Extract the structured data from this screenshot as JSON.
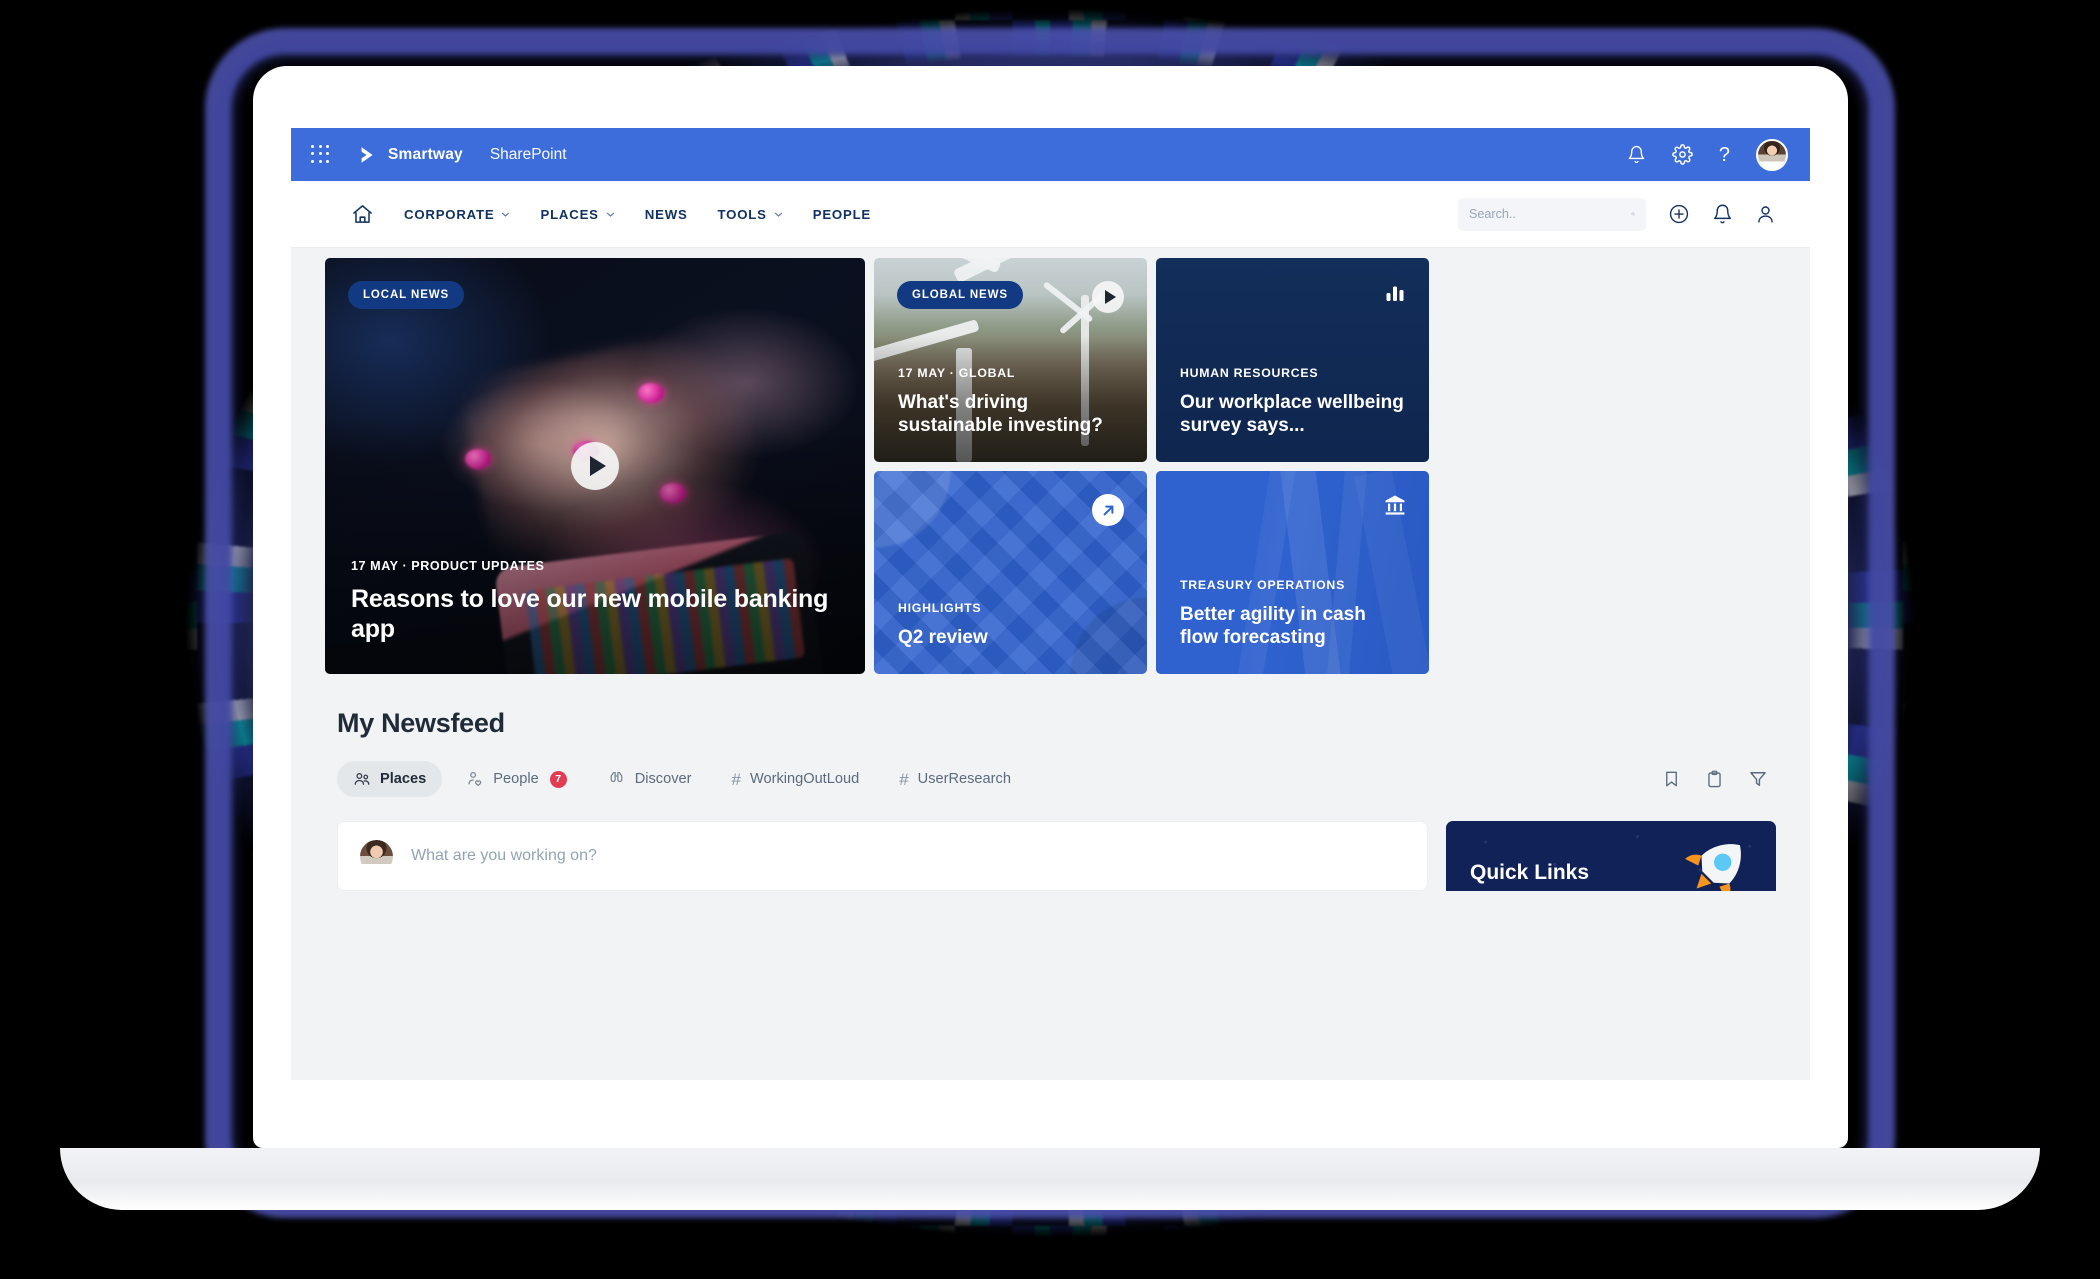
{
  "appbar": {
    "waffle_icon": "app-grid-icon",
    "brand": "Smartway",
    "app_name": "SharePoint",
    "icons": [
      "bell-icon",
      "gear-icon",
      "help-icon"
    ],
    "help_glyph": "?",
    "avatar": "user-avatar"
  },
  "nav": {
    "home_icon": "home-icon",
    "items": [
      {
        "label": "CORPORATE",
        "has_dropdown": true
      },
      {
        "label": "PLACES",
        "has_dropdown": true
      },
      {
        "label": "NEWS",
        "has_dropdown": false
      },
      {
        "label": "TOOLS",
        "has_dropdown": true
      },
      {
        "label": "PEOPLE",
        "has_dropdown": false
      }
    ],
    "search_placeholder": "Search..",
    "search_value": "",
    "right_icons": [
      "plus-circle-icon",
      "bell-icon",
      "person-icon"
    ]
  },
  "cards": {
    "hero": {
      "badge": "LOCAL NEWS",
      "kicker": "17 MAY · PRODUCT UPDATES",
      "title": "Reasons to love our new mobile banking app",
      "has_play": true
    },
    "wind": {
      "badge": "GLOBAL NEWS",
      "kicker": "17 MAY ·  GLOBAL",
      "title": "What's driving sustainable investing?",
      "has_play": true
    },
    "hr": {
      "icon": "bar-chart-icon",
      "kicker": "HUMAN RESOURCES",
      "title": "Our workplace wellbeing survey says..."
    },
    "q2": {
      "icon": "arrow-up-right-icon",
      "kicker": "HIGHLIGHTS",
      "title": "Q2 review"
    },
    "treasury": {
      "icon": "bank-icon",
      "kicker": "TREASURY OPERATIONS",
      "title": "Better agility in cash flow forecasting"
    }
  },
  "newsfeed": {
    "title": "My Newsfeed",
    "tabs": [
      {
        "label": "Places",
        "icon": "people-group-icon",
        "active": true,
        "badge": ""
      },
      {
        "label": "People",
        "icon": "person-heart-icon",
        "active": false,
        "badge": "7"
      },
      {
        "label": "Discover",
        "icon": "binoculars-icon",
        "active": false,
        "badge": ""
      },
      {
        "label": "WorkingOutLoud",
        "icon": "hash-icon",
        "active": false,
        "badge": ""
      },
      {
        "label": "UserResearch",
        "icon": "hash-icon",
        "active": false,
        "badge": ""
      }
    ],
    "actions": [
      "bookmark-icon",
      "clipboard-icon",
      "filter-icon"
    ],
    "composer_placeholder": "What are you working on?",
    "composer_value": "",
    "quick_links_title": "Quick Links",
    "quick_links_icon": "rocket-icon"
  },
  "colors": {
    "appbar_blue": "#3d6ddb",
    "nav_text": "#123262",
    "badge_navy": "#123a82",
    "card_blue": "#2f62cf",
    "card_navy": "#16315f",
    "quicklinks_navy": "#102258",
    "notification_red": "#e23c55",
    "page_bg": "#f1f3f5"
  }
}
